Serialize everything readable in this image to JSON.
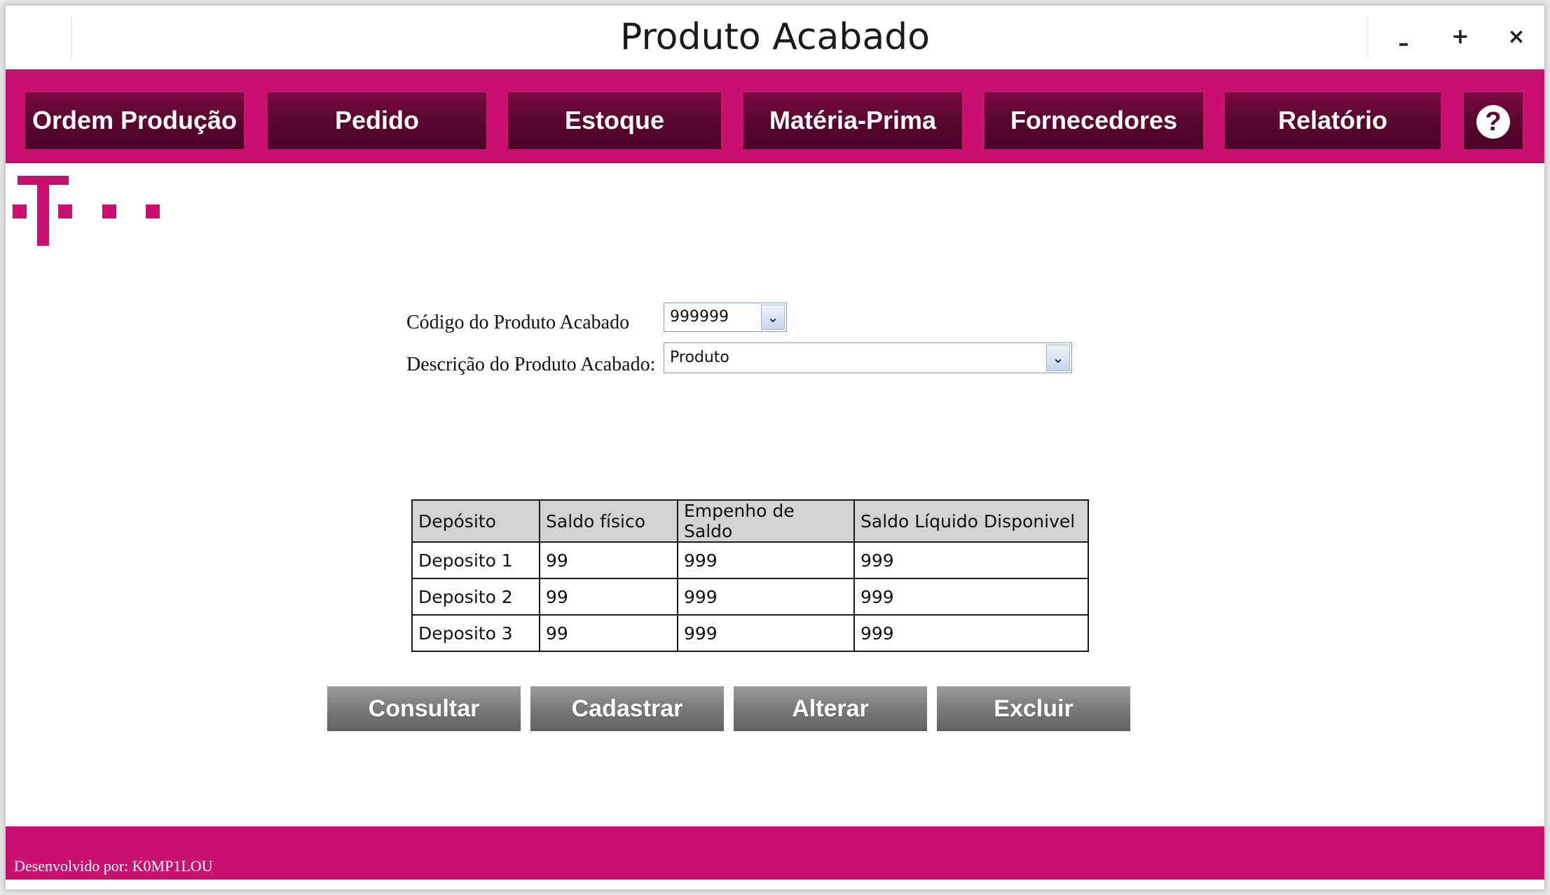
{
  "window": {
    "title": "Produto Acabado",
    "controls": {
      "minimize": "–",
      "maximize": "+",
      "close": "×"
    }
  },
  "menu": {
    "items": [
      "Ordem Produção",
      "Pedido",
      "Estoque",
      "Matéria-Prima",
      "Fornecedores",
      "Relatório"
    ],
    "help": "?"
  },
  "form": {
    "codigo_label": "Código do Produto Acabado",
    "codigo_value": "999999",
    "descricao_label": "Descrição do Produto Acabado:",
    "descricao_value": "Produto"
  },
  "table": {
    "headers": [
      "Depósito",
      "Saldo físico",
      "Empenho de Saldo",
      "Saldo Líquido Disponivel"
    ],
    "rows": [
      [
        "Deposito 1",
        "99",
        "999",
        "999"
      ],
      [
        "Deposito 2",
        "99",
        "999",
        "999"
      ],
      [
        "Deposito 3",
        "99",
        "999",
        "999"
      ]
    ]
  },
  "actions": [
    "Consultar",
    "Cadastrar",
    "Alterar",
    "Excluir"
  ],
  "footer": {
    "text": "Desenvolvido por: K0MP1LOU"
  },
  "colors": {
    "brand": "#c9116f",
    "menu_button": "#5c0631",
    "action_button": "#7a7a7a"
  },
  "icons": {
    "logo": "telekom-t-logo",
    "help": "help-icon",
    "dropdown": "chevron-down-icon"
  }
}
